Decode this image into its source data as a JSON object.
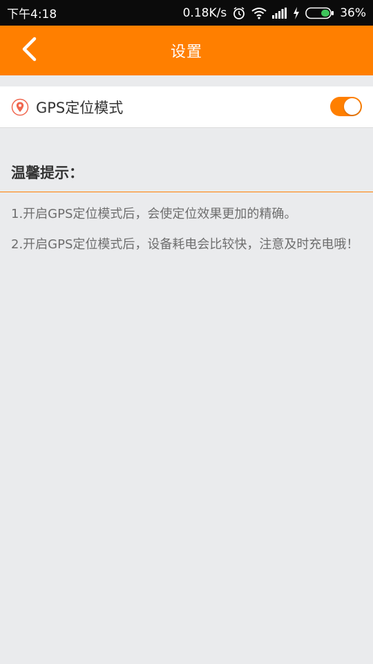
{
  "status_bar": {
    "time": "下午4:18",
    "network_speed": "0.18K/s",
    "battery": "36%",
    "icons": [
      "alarm-icon",
      "wifi-icon",
      "signal-icon",
      "charging-icon",
      "battery-icon"
    ]
  },
  "header": {
    "title": "设置",
    "back_icon": "chevron-left-icon"
  },
  "settings": {
    "gps": {
      "icon": "location-pin-icon",
      "label": "GPS定位模式",
      "enabled": true
    }
  },
  "tips": {
    "title": "温馨提示：",
    "items": [
      "1.开启GPS定位模式后，会使定位效果更加的精确。",
      "2.开启GPS定位模式后，设备耗电会比较快，注意及时充电哦！"
    ]
  },
  "colors": {
    "accent": "#ff7f00",
    "background": "#eaebed",
    "status_bar": "#0b0b0b",
    "battery_fill": "#3ec35a",
    "pin": "#f0664e"
  }
}
